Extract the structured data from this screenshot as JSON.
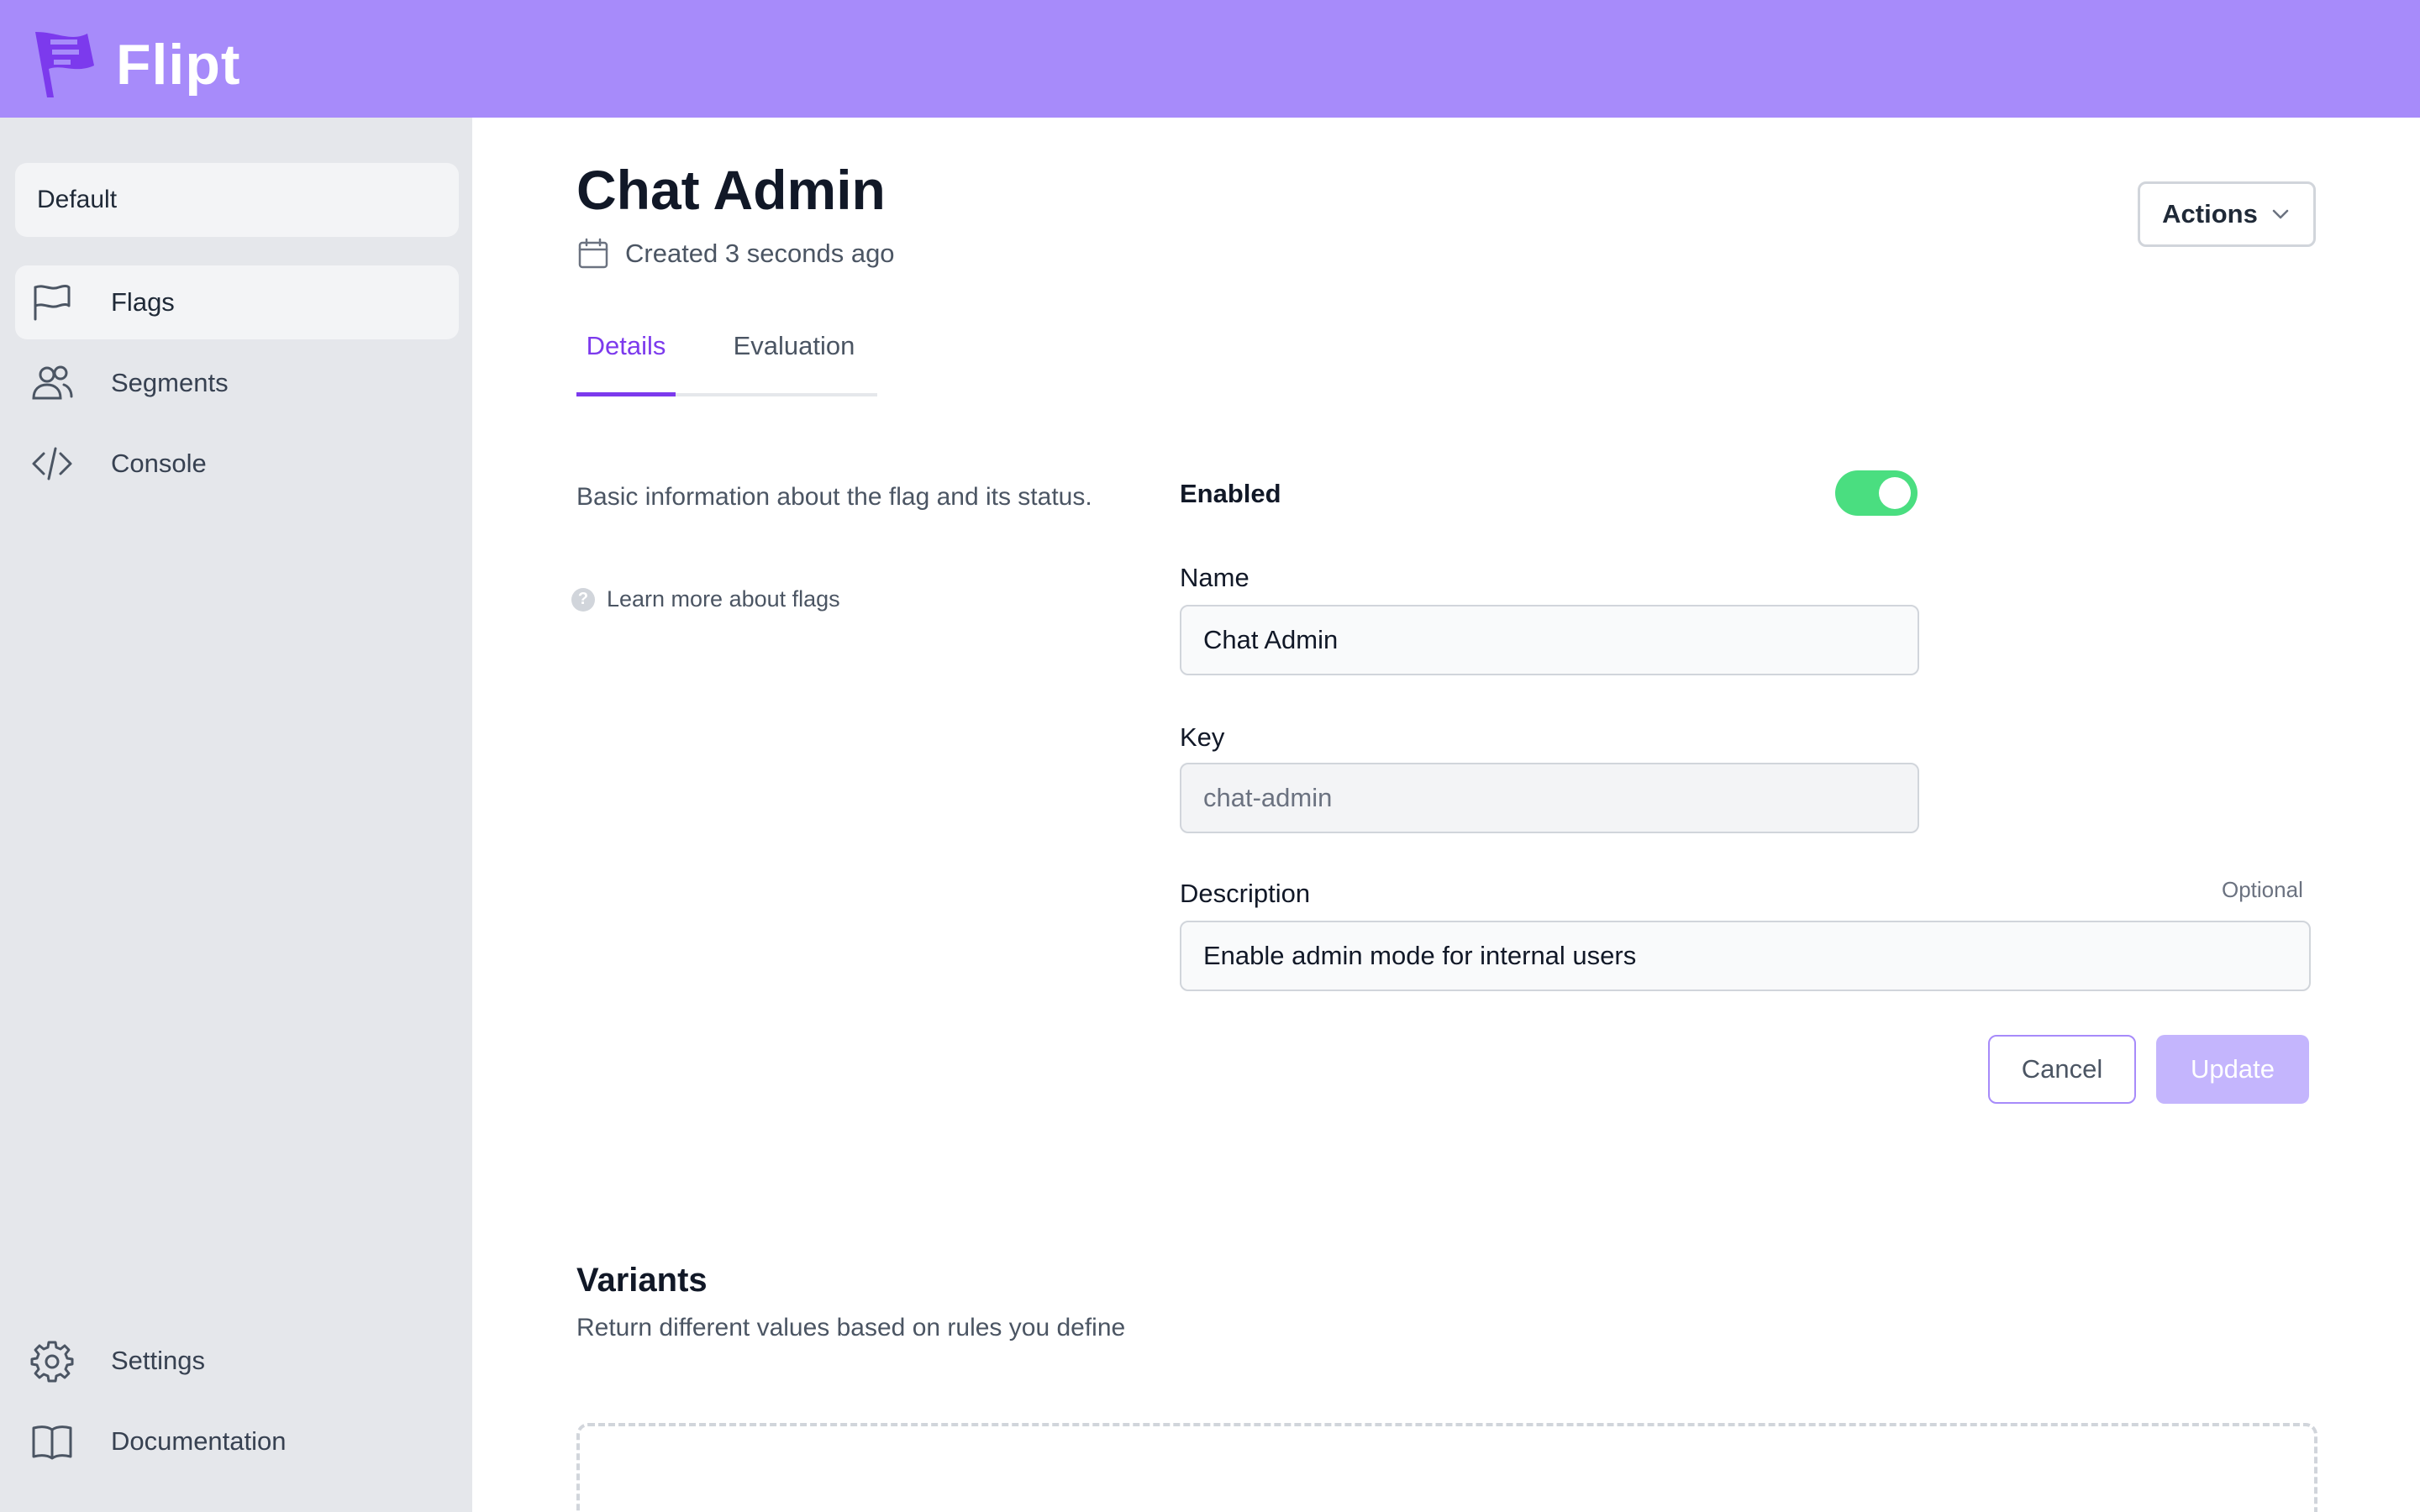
{
  "app": {
    "name": "Flipt",
    "brand_color": "#a78bfa",
    "accent_color": "#7c3aed",
    "toggle_color": "#4ade80"
  },
  "sidebar": {
    "namespace": "Default",
    "items": [
      {
        "label": "Flags",
        "icon": "flag-icon",
        "active": true
      },
      {
        "label": "Segments",
        "icon": "users-icon",
        "active": false
      },
      {
        "label": "Console",
        "icon": "code-icon",
        "active": false
      }
    ],
    "bottom_items": [
      {
        "label": "Settings",
        "icon": "gear-icon"
      },
      {
        "label": "Documentation",
        "icon": "book-icon"
      }
    ]
  },
  "flag": {
    "title": "Chat Admin",
    "created": "Created 3 seconds ago",
    "actions_label": "Actions"
  },
  "tabs": [
    {
      "label": "Details",
      "active": true
    },
    {
      "label": "Evaluation",
      "active": false
    }
  ],
  "details": {
    "description": "Basic information about the flag and its status.",
    "learn_more": "Learn more about flags",
    "enabled_label": "Enabled",
    "enabled": true,
    "name_label": "Name",
    "name_value": "Chat Admin",
    "key_label": "Key",
    "key_value": "chat-admin",
    "description_label": "Description",
    "description_optional": "Optional",
    "description_value": "Enable admin mode for internal users",
    "cancel_label": "Cancel",
    "update_label": "Update"
  },
  "variants": {
    "title": "Variants",
    "subtitle": "Return different values based on rules you define"
  }
}
